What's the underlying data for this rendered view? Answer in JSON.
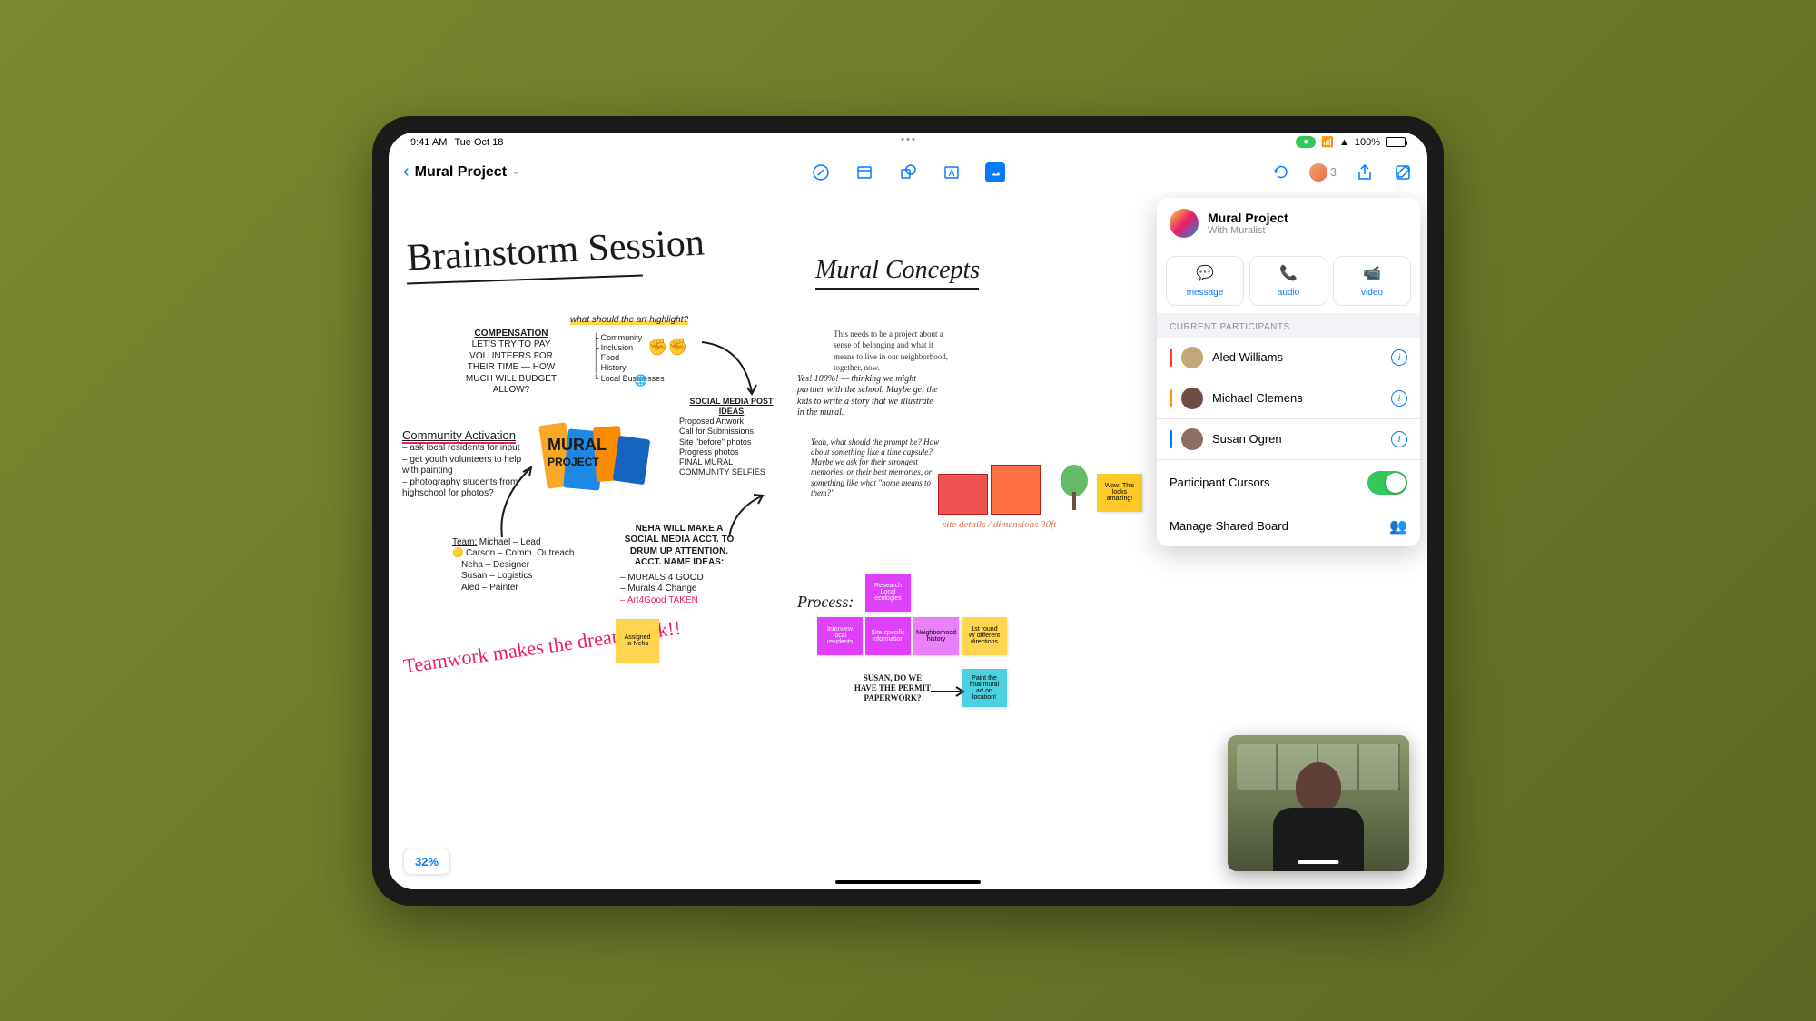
{
  "status": {
    "time": "9:41 AM",
    "date": "Tue Oct 18",
    "battery": "100%",
    "wifi_icon": "wifi",
    "camera_active": true
  },
  "header": {
    "back": "‹",
    "title": "Mural Project",
    "tools": [
      "pen",
      "note",
      "shape",
      "text",
      "media"
    ],
    "participant_count": "3",
    "actions": [
      "undo",
      "participants",
      "share",
      "compose"
    ]
  },
  "canvas": {
    "title1": "Brainstorm Session",
    "title2": "Mural Concepts",
    "compensation": {
      "h": "COMPENSATION",
      "body": "LET'S TRY TO PAY VOLUNTEERS FOR THEIR TIME — HOW MUCH WILL BUDGET ALLOW?"
    },
    "activation": {
      "h": "Community Activation",
      "items": [
        "– ask local residents for input",
        "– get youth volunteers to help with painting",
        "– photography students from highschool for photos?"
      ]
    },
    "team": {
      "h": "Team:",
      "members": [
        "Michael – Lead",
        "Carson – Comm. Outreach",
        "Neha – Designer",
        "Susan – Logistics",
        "Aled – Painter"
      ]
    },
    "highlight": {
      "h": "what should the art highlight?",
      "items": [
        "Community",
        "Inclusion",
        "Food",
        "History",
        "Local Businesses"
      ]
    },
    "social": {
      "h": "SOCIAL MEDIA POST IDEAS",
      "items": [
        "Proposed Artwork",
        "Call for Submissions",
        "Site \"before\" photos",
        "Progress photos",
        "FINAL MURAL",
        "COMMUNITY SELFIES"
      ]
    },
    "neha": "NEHA WILL MAKE A SOCIAL MEDIA ACCT. TO DRUM UP ATTENTION. ACCT. NAME IDEAS:",
    "neha_ideas": [
      "– MURALS 4 GOOD",
      "– Murals 4 Change",
      "– Art4Good  TAKEN"
    ],
    "intro": "This needs to be a project about a sense of belonging and what it means to live in our neighborhood, together, now.",
    "yes": "Yes! 100%! — thinking we might partner with the school. Maybe get the kids to write a story that we illustrate in the mural.",
    "prompt": "Yeah, what should the prompt be? How about something like a time capsule? Maybe we ask for their strongest memories, or their best memories, or something like what \"home means to them?\"",
    "process": "Process:",
    "susan_note": "SUSAN, DO WE HAVE THE PERMIT PAPERWORK?",
    "site_details": "site details / dimensions 30ft",
    "teamwork": "Teamwork makes the dreamwork!!",
    "mural_logo": {
      "line1": "MURAL",
      "line2": "PROJECT"
    },
    "stickies": {
      "neha": "Assigned to Neha",
      "wow": "Wow! This looks amazing!",
      "research": "Research Local ecologies",
      "interview": "Interview local residents",
      "site": "Site specific information",
      "neighborhood": "Neighborhood history",
      "round1": "1st round w/ different directions",
      "paint": "Paint the final mural art on location!"
    }
  },
  "collab": {
    "title": "Mural Project",
    "subtitle": "With Muralist",
    "actions": {
      "message": "message",
      "audio": "audio",
      "video": "video"
    },
    "section_h": "CURRENT PARTICIPANTS",
    "participants": [
      {
        "name": "Aled Williams",
        "color": "#ff3b30"
      },
      {
        "name": "Michael Clemens",
        "color": "#ff9500"
      },
      {
        "name": "Susan Ogren",
        "color": "#007aff"
      }
    ],
    "cursors_label": "Participant Cursors",
    "cursors_on": true,
    "manage_label": "Manage Shared Board"
  },
  "zoom": "32%"
}
